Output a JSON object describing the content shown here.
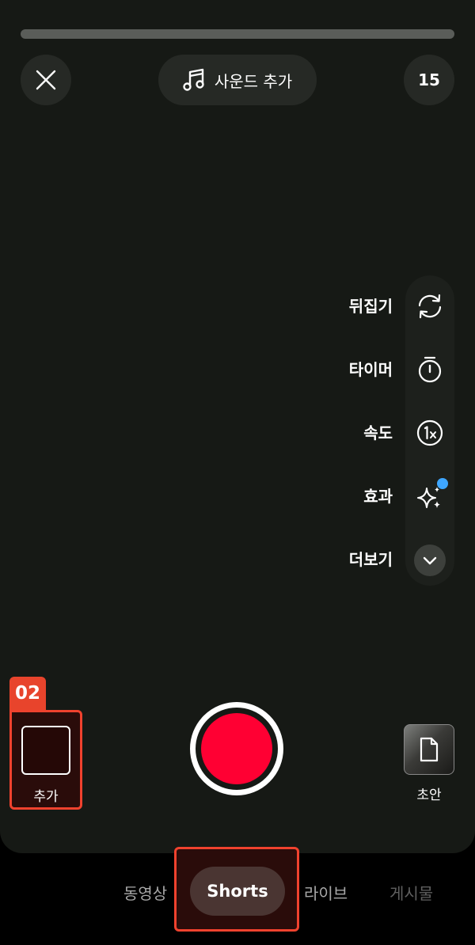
{
  "top": {
    "close_icon": "close-icon",
    "sound_button_label": "사운드 추가",
    "music_icon": "music-note-icon",
    "duration_label": "15"
  },
  "tools": [
    {
      "label": "뒤집기",
      "icon": "flip-camera-icon"
    },
    {
      "label": "타이머",
      "icon": "timer-icon"
    },
    {
      "label": "속도",
      "icon": "speed-1x-icon"
    },
    {
      "label": "효과",
      "icon": "sparkle-effects-icon"
    },
    {
      "label": "더보기",
      "icon": "chevron-down-icon"
    }
  ],
  "bottom_controls": {
    "badge": "02",
    "add_label": "추가",
    "draft_label": "초안"
  },
  "tabs": {
    "video": "동영상",
    "shorts": "Shorts",
    "live": "라이브",
    "post": "게시물"
  },
  "colors": {
    "record": "#ff0033",
    "highlight": "#f0422e",
    "background": "#161915",
    "notification_dot": "#3ea6ff"
  }
}
